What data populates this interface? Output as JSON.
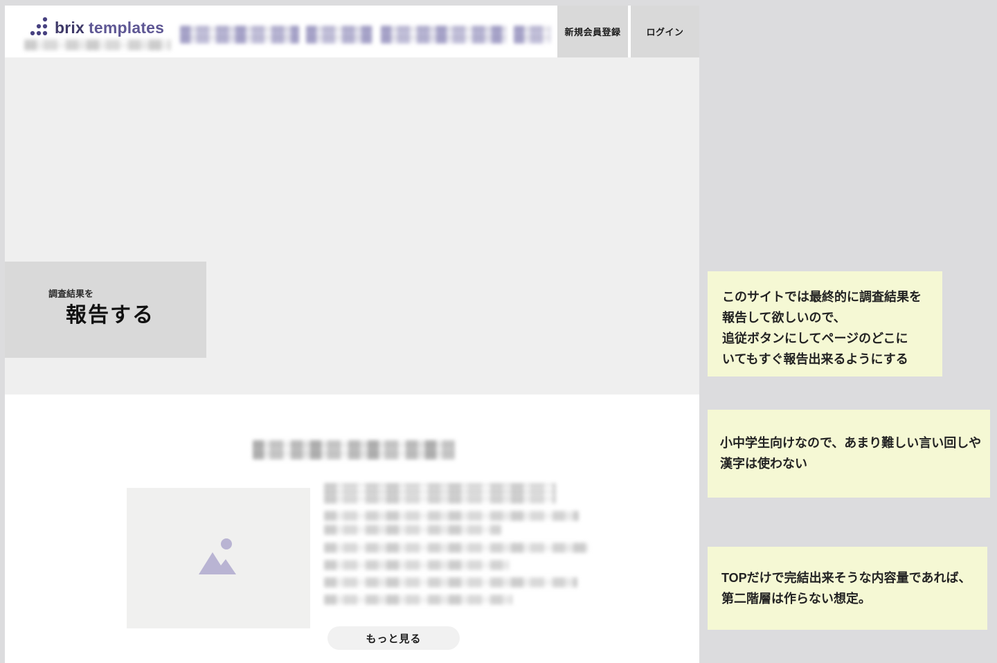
{
  "colors": {
    "canvas_background": "#dcdcde",
    "page_background": "#ffffff",
    "hero_background": "#efefef",
    "gray_button": "#d9d9d9",
    "note_background": "#f5f8d4",
    "brand_dark": "#3e3968",
    "brand_light": "#5e5794",
    "placeholder_icon": "#b9b4d3",
    "pill_background": "#f1f1f1"
  },
  "header": {
    "logo": {
      "icon": "brix-dots-logo-icon",
      "brand_bold": "brix",
      "brand_light": "templates"
    },
    "buttons": [
      {
        "label": "新規会員登録"
      },
      {
        "label": "ログイン"
      }
    ]
  },
  "sticky_report": {
    "eyebrow": "調査結果を",
    "label": "報告する"
  },
  "content": {
    "placeholder_icon": "mountain-photo-icon",
    "more_button_label": "もっと見る"
  },
  "notes": [
    {
      "text": "このサイトでは最終的に調査結果を\n報告して欲しいので、\n追従ボタンにしてページのどこに\nいてもすぐ報告出来るようにする"
    },
    {
      "text": "小中学生向けなので、あまり難しい言い回しや\n漢字は使わない"
    },
    {
      "text": "TOPだけで完結出来そうな内容量であれば、\n第二階層は作らない想定。"
    }
  ]
}
